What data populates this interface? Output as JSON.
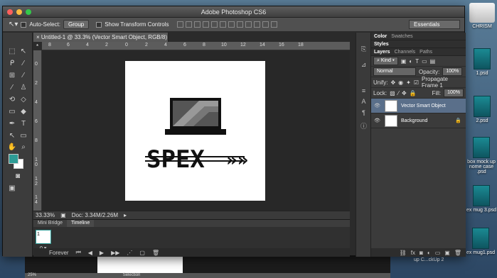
{
  "app": {
    "title": "Adobe Photoshop CS6"
  },
  "options_bar": {
    "auto_select_label": "Auto-Select:",
    "auto_select_value": "Group",
    "transform_label": "Show Transform Controls",
    "workspace": "Essentials"
  },
  "document": {
    "tab_title": "Untitled-1 @ 33.3% (Vector Smart Object, RGB/8) *",
    "zoom": "33.33%",
    "doc_size": "Doc: 3.34M/2.26M"
  },
  "rulers": {
    "h_ticks": [
      "8",
      "6",
      "4",
      "2",
      "0",
      "2",
      "4",
      "6",
      "8",
      "10",
      "12",
      "14",
      "16",
      "18"
    ],
    "v_ticks": [
      "0",
      "2",
      "4",
      "6",
      "8",
      "1 0",
      "1 2",
      "1 4"
    ]
  },
  "bottom_panel": {
    "tabs": [
      "Mini Bridge",
      "Timeline"
    ],
    "frame_time": "0 ▾",
    "loop": "Forever",
    "frame_number": "1"
  },
  "panels": {
    "top_tabs": [
      "Color",
      "Swatches"
    ],
    "styles_tab": "Styles",
    "layer_tabs": [
      "Layers",
      "Channels",
      "Paths"
    ],
    "kind_label": "Kind",
    "blend_mode": "Normal",
    "opacity_label": "Opacity:",
    "opacity_value": "100%",
    "unify_label": "Unify:",
    "propagate_label": "Propagate Frame 1",
    "lock_label": "Lock:",
    "fill_label": "Fill:",
    "fill_value": "100%",
    "layers": [
      {
        "name": "Vector Smart Object",
        "active": true
      },
      {
        "name": "Background",
        "active": false
      }
    ]
  },
  "desktop": {
    "items": [
      {
        "label": "CHRISM"
      },
      {
        "label": "1.psd"
      },
      {
        "label": "2.psd"
      },
      {
        "label": "box mock up\nnome case .psd"
      },
      {
        "label": "ex mug 3.psd"
      },
      {
        "label": "ex mug1.psd"
      }
    ],
    "mockup_label": "up C...ckUp 2"
  },
  "taskbar": {
    "zoom": "25%",
    "selection": "Selection"
  },
  "artwork": {
    "text": "SPEX"
  }
}
